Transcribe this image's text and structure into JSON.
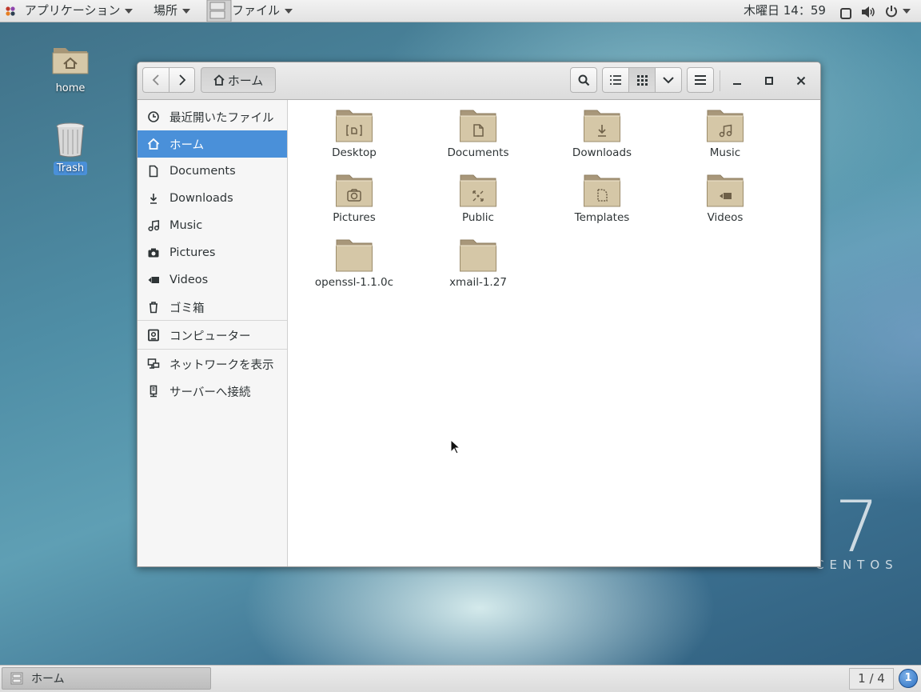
{
  "top_panel": {
    "applications_label": "アプリケーション",
    "places_label": "場所",
    "app_menu_label": "ファイル",
    "clock": "木曜日 14：59"
  },
  "desktop": {
    "icons": [
      {
        "label": "home",
        "icon": "home-folder-icon"
      },
      {
        "label": "Trash",
        "icon": "trash-icon"
      }
    ],
    "branding": {
      "number": "7",
      "word": "CENTOS"
    }
  },
  "window": {
    "nav": {
      "back_icon": "chevron-left-icon",
      "forward_icon": "chevron-right-icon"
    },
    "path_button_label": "ホーム",
    "view": {
      "mode": "icon-grid"
    },
    "sidebar": {
      "items": [
        {
          "label": "最近開いたファイル",
          "icon": "clock-icon",
          "selected": false
        },
        {
          "label": "ホーム",
          "icon": "home-icon",
          "selected": true
        },
        {
          "label": "Documents",
          "icon": "document-icon",
          "selected": false
        },
        {
          "label": "Downloads",
          "icon": "download-icon",
          "selected": false
        },
        {
          "label": "Music",
          "icon": "music-icon",
          "selected": false
        },
        {
          "label": "Pictures",
          "icon": "camera-icon",
          "selected": false
        },
        {
          "label": "Videos",
          "icon": "video-icon",
          "selected": false
        },
        {
          "label": "ゴミ箱",
          "icon": "trash-icon",
          "selected": false
        },
        {
          "label": "コンピューター",
          "icon": "computer-icon",
          "selected": false
        },
        {
          "label": "ネットワークを表示",
          "icon": "network-icon",
          "selected": false
        },
        {
          "label": "サーバーへ接続",
          "icon": "server-icon",
          "selected": false
        }
      ]
    },
    "files": [
      {
        "name": "Desktop",
        "emblem": "desktop"
      },
      {
        "name": "Documents",
        "emblem": "documents"
      },
      {
        "name": "Downloads",
        "emblem": "downloads"
      },
      {
        "name": "Music",
        "emblem": "music"
      },
      {
        "name": "Pictures",
        "emblem": "pictures"
      },
      {
        "name": "Public",
        "emblem": "public"
      },
      {
        "name": "Templates",
        "emblem": "templates"
      },
      {
        "name": "Videos",
        "emblem": "videos"
      },
      {
        "name": "openssl-1.1.0c",
        "emblem": "none"
      },
      {
        "name": "xmail-1.27",
        "emblem": "none"
      }
    ]
  },
  "bottom_panel": {
    "task_label": "ホーム",
    "workspace": "1 / 4",
    "notification_count": "1"
  },
  "colors": {
    "selection": "#4a90d9",
    "folder": "#d2c3a3"
  }
}
